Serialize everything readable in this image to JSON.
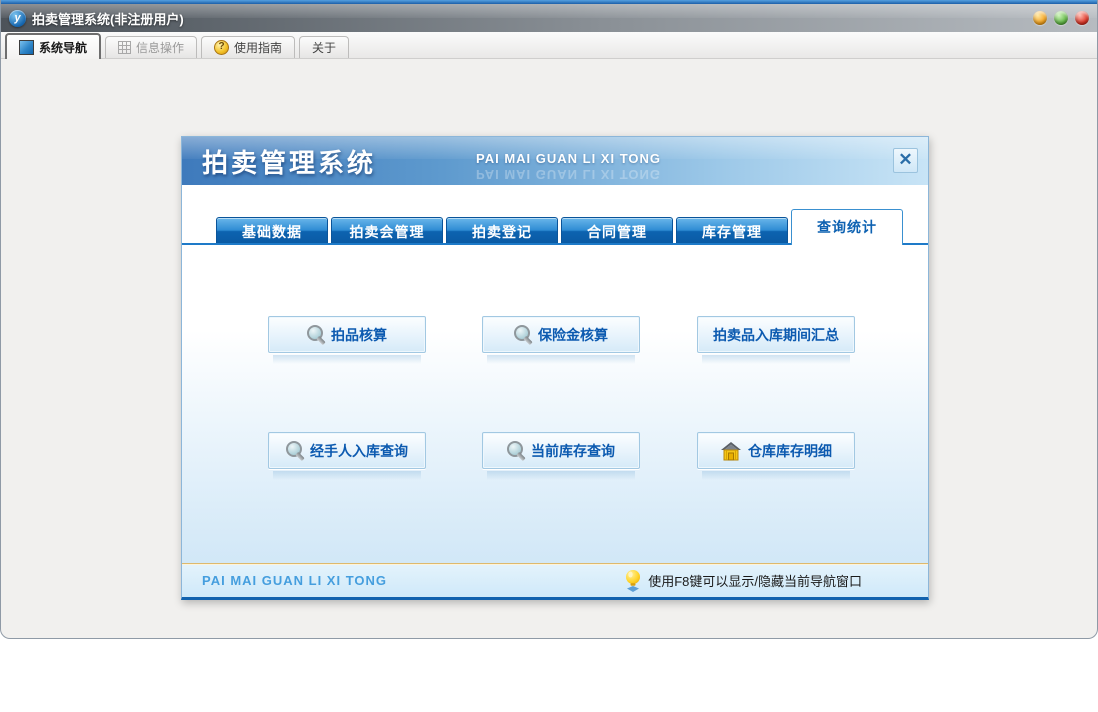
{
  "window": {
    "title": "拍卖管理系统(非注册用户)",
    "controls": [
      {
        "name": "minimize",
        "color": "#f6a623"
      },
      {
        "name": "maximize",
        "color": "#66bb4a"
      },
      {
        "name": "close",
        "color": "#e0392a"
      }
    ]
  },
  "icons": {
    "logo_glyph": "y",
    "question_glyph": "?",
    "close_glyph": "✕"
  },
  "main_tabs": [
    {
      "label": "系统导航",
      "icon": "navigation-icon",
      "active": true
    },
    {
      "label": "信息操作",
      "icon": "grid-icon",
      "active": false
    },
    {
      "label": "使用指南",
      "icon": "question-icon",
      "active": false
    },
    {
      "label": "关于",
      "icon": "",
      "active": false
    }
  ],
  "dialog": {
    "title": "拍卖管理系统",
    "subtitle": "PAI MAI GUAN LI XI TONG",
    "tabs": [
      {
        "label": "基础数据",
        "active": false
      },
      {
        "label": "拍卖会管理",
        "active": false
      },
      {
        "label": "拍卖登记",
        "active": false
      },
      {
        "label": "合同管理",
        "active": false
      },
      {
        "label": "库存管理",
        "active": false
      },
      {
        "label": "查询统计",
        "active": true
      }
    ],
    "buttons": [
      {
        "label": "拍品核算",
        "icon": "magnifier-icon"
      },
      {
        "label": "保险金核算",
        "icon": "magnifier-icon"
      },
      {
        "label": "拍卖品入库期间汇总",
        "icon": ""
      },
      {
        "label": "经手人入库查询",
        "icon": "magnifier-icon"
      },
      {
        "label": "当前库存查询",
        "icon": "magnifier-icon"
      },
      {
        "label": "仓库库存明细",
        "icon": "warehouse-icon"
      }
    ],
    "footer": {
      "left_text": "PAI MAI GUAN LI XI TONG",
      "tip_text": "使用F8键可以显示/隐藏当前导航窗口"
    }
  },
  "colors": {
    "accent_blue": "#1472c8",
    "dialog_tab_blue": "#0d63b0",
    "button_text_blue": "#0c5ab0",
    "footer_brand_blue": "#459ede",
    "footer_rule_tan": "#ddb96e"
  }
}
